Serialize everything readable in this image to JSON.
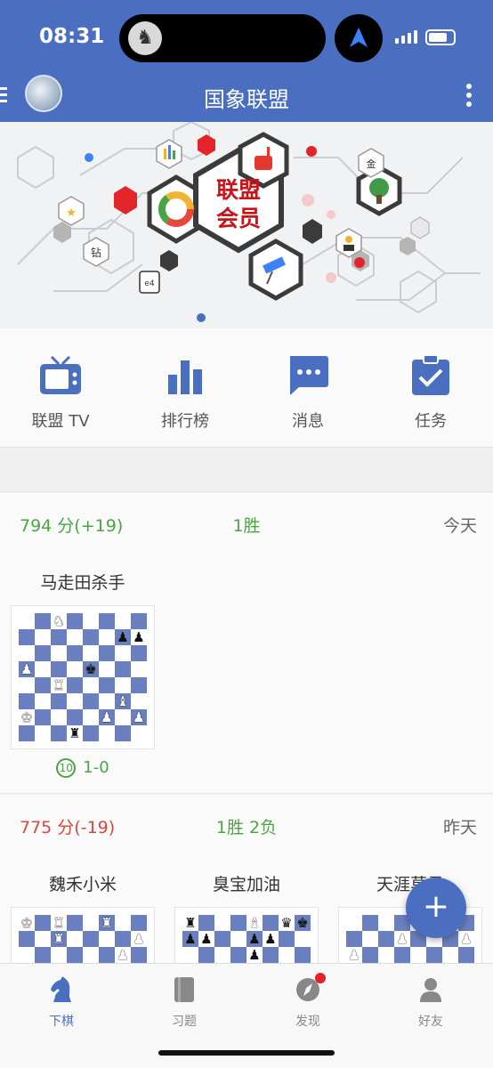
{
  "status_bar": {
    "time": "08:31"
  },
  "header": {
    "title": "国象联盟"
  },
  "banner": {
    "line1": "联盟",
    "line2": "会员",
    "tag_diamond": "钻",
    "tag_gold": "金",
    "tag_e4": "e4"
  },
  "quick_actions": [
    {
      "label": "联盟 TV",
      "icon": "tv-icon"
    },
    {
      "label": "排行榜",
      "icon": "leaderboard-icon"
    },
    {
      "label": "消息",
      "icon": "message-icon"
    },
    {
      "label": "任务",
      "icon": "task-icon"
    }
  ],
  "sections": [
    {
      "rating": "794 分(+19)",
      "record": "1胜",
      "day": "今天",
      "games": [
        {
          "opponent": "马走田杀手",
          "result": "1-0",
          "clock": "10"
        }
      ]
    },
    {
      "rating": "775 分(-19)",
      "record": "1胜 2负",
      "day": "昨天",
      "games": [
        {
          "opponent": "魏禾小米"
        },
        {
          "opponent": "臭宝加油"
        },
        {
          "opponent": "天涯莫寻"
        }
      ]
    }
  ],
  "fab": {
    "label": "+"
  },
  "tabbar": [
    {
      "label": "下棋",
      "icon": "knight-icon"
    },
    {
      "label": "习题",
      "icon": "book-icon"
    },
    {
      "label": "发现",
      "icon": "compass-icon"
    },
    {
      "label": "好友",
      "icon": "person-icon"
    }
  ],
  "colors": {
    "brand": "#4a6fc1",
    "win": "#4aa544",
    "loss": "#d9453b",
    "badge": "#e3242b"
  }
}
